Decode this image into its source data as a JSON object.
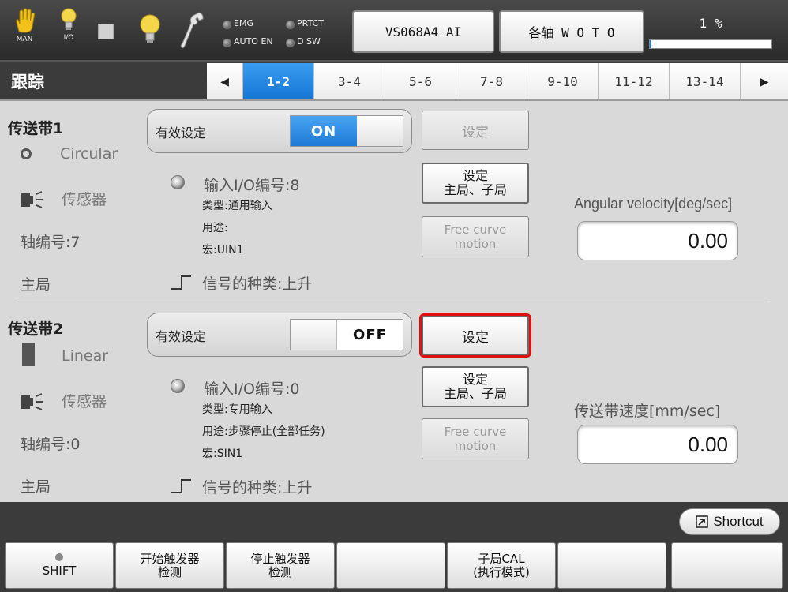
{
  "top": {
    "mode_label": "MAN",
    "io_label": "I/O",
    "indicators": [
      "EMG",
      "PRTCT",
      "AUTO EN",
      "D SW"
    ],
    "robot_button": "VS068A4 AI",
    "axis_button": "各轴 W O T O",
    "speed_text": "1 %",
    "speed_percent": 1
  },
  "header": {
    "title": "跟踪",
    "tabs": [
      "1-2",
      "3-4",
      "5-6",
      "7-8",
      "9-10",
      "11-12",
      "13-14"
    ],
    "active_tab": "1-2",
    "prev_icon": "◀",
    "next_icon": "▶"
  },
  "conveyor1": {
    "name": "传送带1",
    "type": "Circular",
    "sensor_label": "传感器",
    "axis_label": "轴编号:7",
    "master_label": "主局",
    "enable_label": "有效设定",
    "toggle_text": "ON",
    "set_button": "设定",
    "master_slave_line1": "设定",
    "master_slave_line2": "主局、子局",
    "free_curve_line1": "Free curve",
    "free_curve_line2": "motion",
    "input_io": "输入I/O编号:8",
    "io_type": "类型:通用输入",
    "io_use": "用途:",
    "io_macro": "宏:UIN1",
    "signal_kind": "信号的种类:上升",
    "velocity_label": "Angular velocity[deg/sec]",
    "velocity_value": "0.00"
  },
  "conveyor2": {
    "name": "传送带2",
    "type": "Linear",
    "sensor_label": "传感器",
    "axis_label": "轴编号:0",
    "master_label": "主局",
    "enable_label": "有效设定",
    "toggle_text": "OFF",
    "set_button": "设定",
    "master_slave_line1": "设定",
    "master_slave_line2": "主局、子局",
    "free_curve_line1": "Free curve",
    "free_curve_line2": "motion",
    "input_io": "输入I/O编号:0",
    "io_type": "类型:专用输入",
    "io_use": "用途:步骤停止(全部任务)",
    "io_macro": "宏:SIN1",
    "signal_kind": "信号的种类:上升",
    "velocity_label": "传送带速度[mm/sec]",
    "velocity_value": "0.00"
  },
  "shortcut_label": "Shortcut",
  "function_keys": [
    {
      "line1": "",
      "line2": "SHIFT"
    },
    {
      "line1": "开始触发器",
      "line2": "检测"
    },
    {
      "line1": "停止触发器",
      "line2": "检测"
    },
    {
      "line1": "",
      "line2": ""
    },
    {
      "line1": "子局CAL",
      "line2": "(执行模式)"
    },
    {
      "line1": "",
      "line2": ""
    },
    {
      "line1": "",
      "line2": ""
    }
  ]
}
